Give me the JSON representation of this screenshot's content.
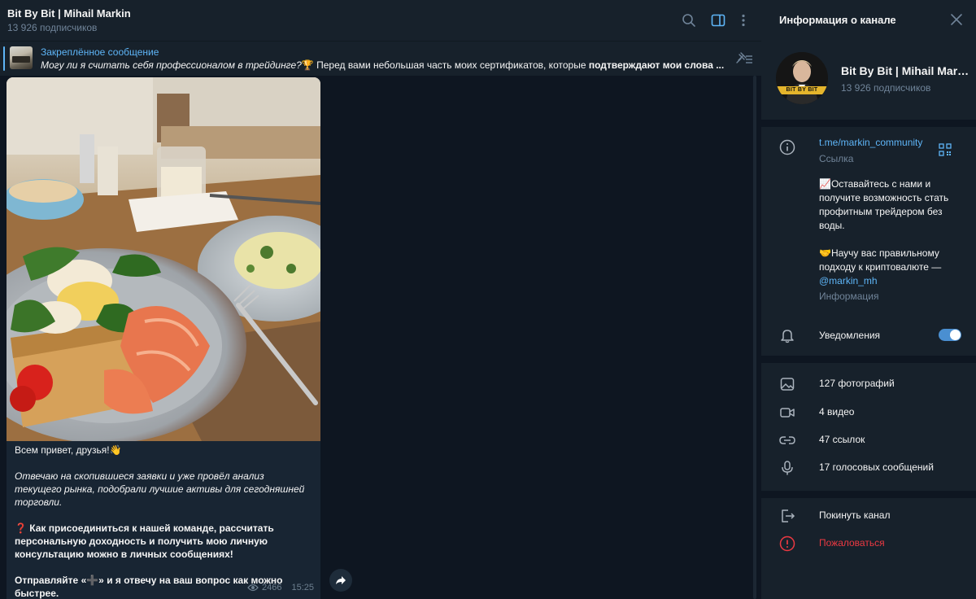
{
  "chat": {
    "title": "Bit By Bit | Mihail Markin",
    "subscribers": "13 926 подписчиков"
  },
  "pinned": {
    "title": "Закреплённое сообщение",
    "text_italic": "Могу ли я считать себя профессионалом в трейдинге?",
    "emoji": "🏆",
    "text_plain": " Перед вами небольшая часть моих сертификатов, которые ",
    "text_bold": "подтверждают мои слова ..."
  },
  "message": {
    "greeting": "Всем привет, друзья!👋",
    "para1": "Отвечаю на скопившиеся заявки и уже провёл анализ текущего рынка, подобрали лучшие активы для сегодняшней торговли.",
    "para2": "❓ Как присоединиться к нашей команде, рассчитать персональную доходность и получить мою личную консультацию можно в личных сообщениях!",
    "para3": "Отправляйте «➕» и я отвечу на ваш вопрос как можно быстрее.",
    "views": "2466",
    "time": "15:25"
  },
  "panel": {
    "title": "Информация о канале",
    "name": "Bit By Bit | Mihail Markin",
    "subscribers": "13 926 подписчиков",
    "avatar_text": "BIT BY BIT",
    "link": "t.me/markin_community",
    "link_caption": "Ссылка",
    "desc_p1": "📈Оставайтесь с нами и получите возможность стать профитным трейдером без воды.",
    "desc_p2": "🤝Научу вас правильному подходу к криптовалюте — ",
    "desc_mention": "@markin_mh",
    "desc_caption": "Информация",
    "notifications": "Уведомления",
    "notifications_on": true,
    "media": [
      {
        "icon": "photo-icon",
        "label": "127 фотографий"
      },
      {
        "icon": "video-icon",
        "label": "4 видео"
      },
      {
        "icon": "link-icon",
        "label": "47 ссылок"
      },
      {
        "icon": "microphone-icon",
        "label": "17 голосовых сообщений"
      }
    ],
    "leave": "Покинуть канал",
    "report": "Пожаловаться"
  },
  "colors": {
    "accent": "#5eb5f7",
    "danger": "#ec3942",
    "background": "#0e1621",
    "panel": "#17212b",
    "bubble": "#182533"
  }
}
